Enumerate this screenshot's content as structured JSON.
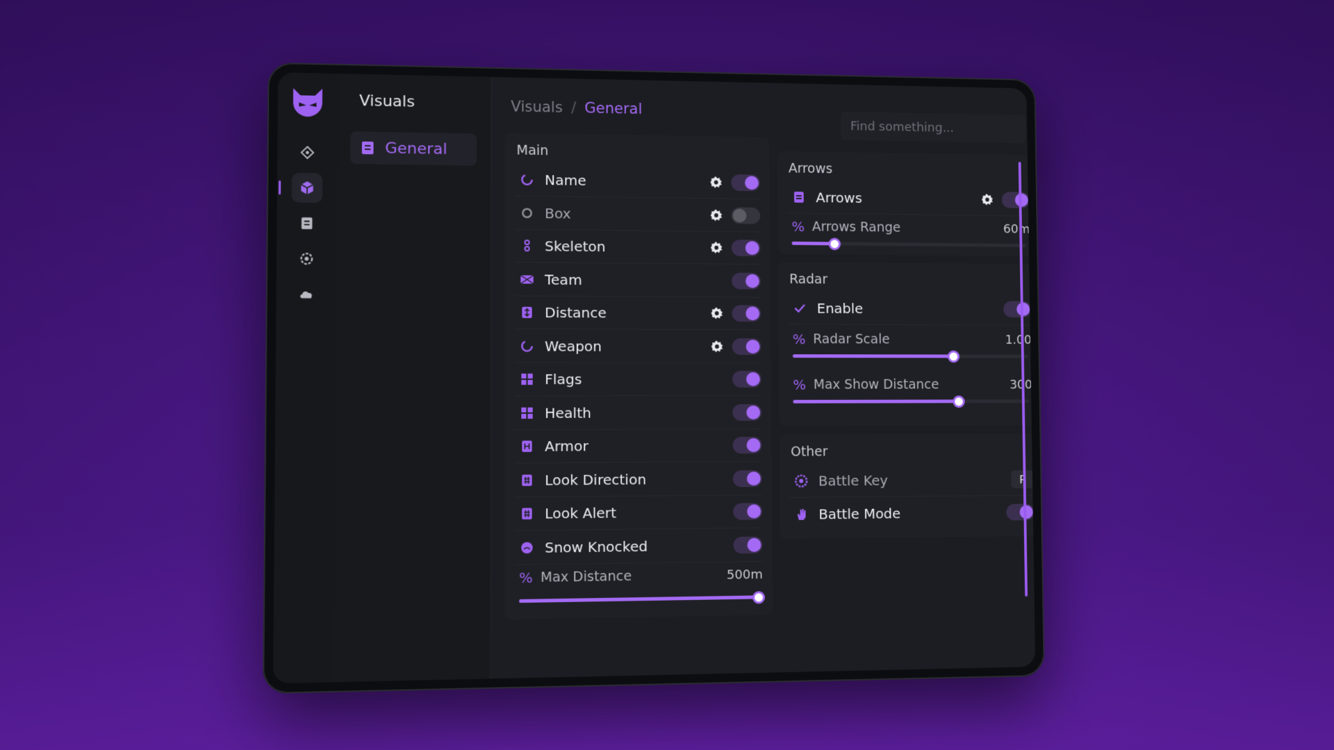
{
  "sidebar": {
    "title": "Visuals",
    "items": [
      {
        "label": "General",
        "icon": "list-icon"
      }
    ]
  },
  "rail": {
    "icons": [
      "logo-icon",
      "crosshair-icon",
      "cube-icon",
      "list-icon",
      "settings-icon",
      "cloud-icon"
    ],
    "active_index": 2
  },
  "breadcrumb": {
    "root": "Visuals",
    "separator": "/",
    "current": "General"
  },
  "search": {
    "placeholder": "Find something..."
  },
  "main_panel": {
    "title": "Main",
    "rows": [
      {
        "label": "Name",
        "icon": "spinner-icon",
        "gear": true,
        "on": true
      },
      {
        "label": "Box",
        "icon": "circle-icon",
        "gear": true,
        "on": false
      },
      {
        "label": "Skeleton",
        "icon": "skeleton-icon",
        "gear": true,
        "on": true
      },
      {
        "label": "Team",
        "icon": "team-icon",
        "gear": false,
        "on": true
      },
      {
        "label": "Distance",
        "icon": "distance-icon",
        "gear": true,
        "on": true
      },
      {
        "label": "Weapon",
        "icon": "spinner-icon",
        "gear": true,
        "on": true
      },
      {
        "label": "Flags",
        "icon": "flag-icon",
        "gear": false,
        "on": true
      },
      {
        "label": "Health",
        "icon": "health-icon",
        "gear": false,
        "on": true
      },
      {
        "label": "Armor",
        "icon": "armor-icon",
        "gear": false,
        "on": true
      },
      {
        "label": "Look Direction",
        "icon": "grid-icon",
        "gear": false,
        "on": true
      },
      {
        "label": "Look Alert",
        "icon": "grid-icon",
        "gear": false,
        "on": true
      },
      {
        "label": "Snow Knocked",
        "icon": "knocked-icon",
        "gear": false,
        "on": true
      }
    ],
    "slider": {
      "label": "Max Distance",
      "value": "500m",
      "fraction": 1.0
    }
  },
  "arrows_panel": {
    "title": "Arrows",
    "toggle": {
      "label": "Arrows",
      "icon": "list-icon",
      "gear": true,
      "on": true
    },
    "slider": {
      "label": "Arrows Range",
      "value": "60m",
      "fraction": 0.18
    }
  },
  "radar_panel": {
    "title": "Radar",
    "toggle": {
      "label": "Enable",
      "icon": "check-icon",
      "on": true
    },
    "sliders": [
      {
        "label": "Radar Scale",
        "value": "1.00",
        "fraction": 0.68
      },
      {
        "label": "Max Show Distance",
        "value": "300",
        "fraction": 0.7
      }
    ]
  },
  "other_panel": {
    "title": "Other",
    "key": {
      "label": "Battle Key",
      "icon": "gear-badge-icon",
      "value": "P"
    },
    "toggle": {
      "label": "Battle Mode",
      "icon": "hand-icon",
      "on": true
    }
  },
  "colors": {
    "accent": "#a46af4",
    "background": "#3d1470",
    "panel": "#1f2025"
  }
}
